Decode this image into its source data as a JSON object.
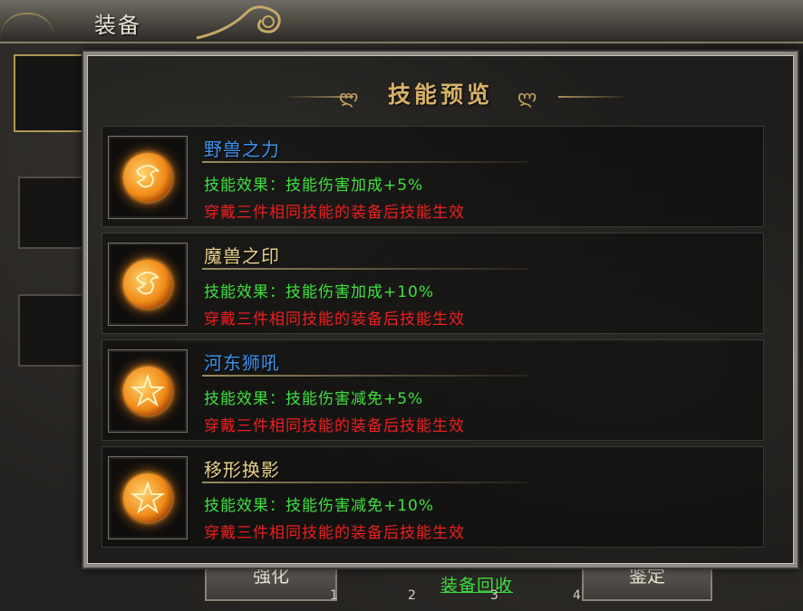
{
  "window": {
    "title": "装备"
  },
  "bottom": {
    "left_button": "强化",
    "right_button": "鉴定",
    "recycle_link": "装备回收",
    "tabs": [
      "1",
      "2",
      "3",
      "4"
    ]
  },
  "popup": {
    "title": "技能预览",
    "skills": [
      {
        "name": "野兽之力",
        "name_color": "#3f93f0",
        "effect": "技能效果：技能伤害加成+5%",
        "condition": "穿戴三件相同技能的装备后技能生效",
        "icon": "beast-skill-icon"
      },
      {
        "name": "魔兽之印",
        "name_color": "#e8d28a",
        "effect": "技能效果：技能伤害加成+10%",
        "condition": "穿戴三件相同技能的装备后技能生效",
        "icon": "beast-skill-icon"
      },
      {
        "name": "河东狮吼",
        "name_color": "#3f93f0",
        "effect": "技能效果：技能伤害减免+5%",
        "condition": "穿戴三件相同技能的装备后技能生效",
        "icon": "star-seal-icon"
      },
      {
        "name": "移形换影",
        "name_color": "#e8d28a",
        "effect": "技能效果：技能伤害减免+10%",
        "condition": "穿戴三件相同技能的装备后技能生效",
        "icon": "star-seal-icon"
      }
    ]
  },
  "colors": {
    "effect_text": "#3fe13f",
    "condition_text": "#ee1f1f",
    "title_gold": "#d7b267"
  }
}
